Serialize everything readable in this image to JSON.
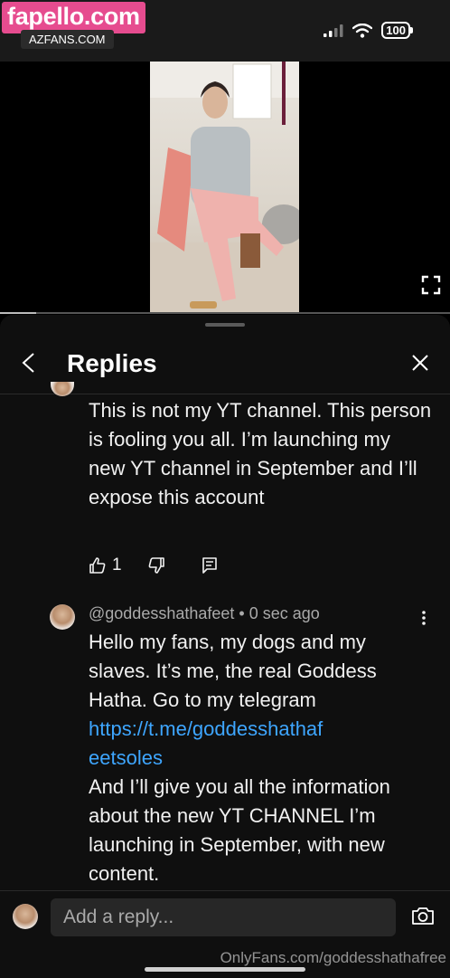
{
  "watermark": {
    "site": "fapello.com",
    "site_sub": "AZFANS.COM",
    "footer": "OnlyFans.com/goddesshathafree"
  },
  "status_bar": {
    "battery": "100"
  },
  "panel": {
    "title": "Replies"
  },
  "comments": [
    {
      "text": "This is not my YT channel. This person is fooling you all. I’m launching my new YT channel in September and I’ll expose this account",
      "likes": "1"
    },
    {
      "author": "@goddesshathafeet",
      "time": "0 sec ago",
      "text_before_link": "Hello my fans, my dogs and my slaves. It’s me, the real Goddess Hatha. Go to my telegram",
      "link": "https://t.me/goddesshathafeetsoles",
      "text_after_link": "And I’ll give you all the  information about the new YT CHANNEL I’m launching in September, with new content."
    }
  ],
  "reply": {
    "placeholder": "Add a reply..."
  },
  "icons": {
    "back": "chevron-left-icon",
    "close": "close-icon",
    "like": "thumbs-up-icon",
    "dislike": "thumbs-down-icon",
    "reply": "comment-icon",
    "more": "kebab-icon",
    "camera": "camera-icon",
    "fullscreen": "fullscreen-icon"
  },
  "colors": {
    "brand_watermark": "#e64c8f",
    "link": "#3ea6ff",
    "panel_bg": "#0f0f0f"
  },
  "video": {
    "progress": 0.08
  }
}
